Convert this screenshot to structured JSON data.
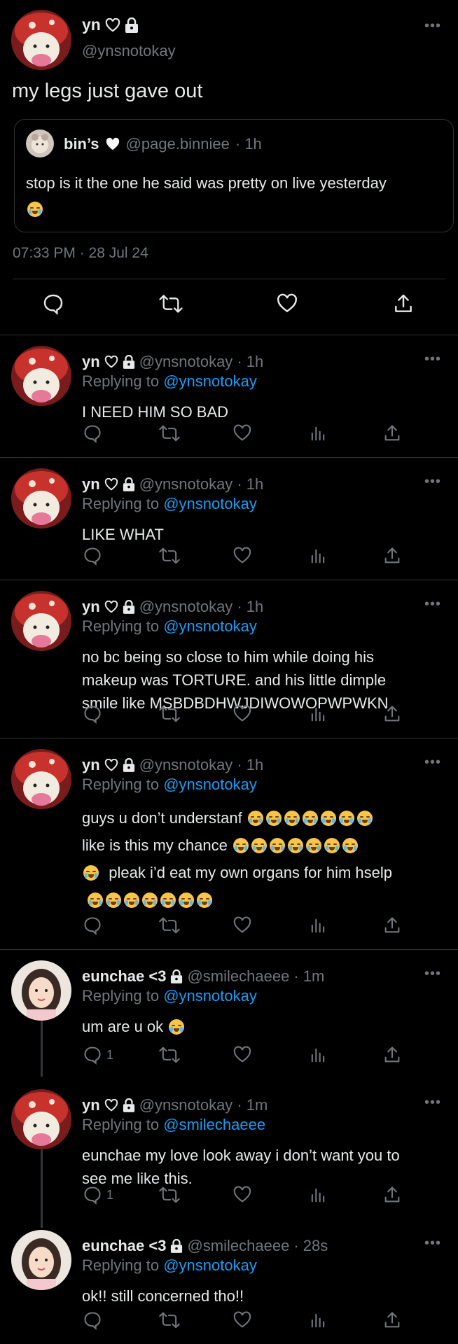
{
  "main_tweet": {
    "author_name": "yn",
    "author_handle": "@ynsnotokay",
    "text": "my legs just gave out",
    "quote": {
      "author_name": "bin’s",
      "author_handle": "@page.binniee",
      "time": "· 1h",
      "text": "stop is it the one he said was pretty on live yesterday"
    },
    "timestamp": "07:33 PM · 28 Jul 24"
  },
  "replies": [
    {
      "name": "yn",
      "handle": "@ynsnotokay",
      "time": "· 1h",
      "replying_label": "Replying to",
      "replying_to": "@ynsnotokay",
      "lines": [
        "I NEED HIM SO BAD"
      ],
      "reply_count": ""
    },
    {
      "name": "yn",
      "handle": "@ynsnotokay",
      "time": "· 1h",
      "replying_label": "Replying to",
      "replying_to": "@ynsnotokay",
      "lines": [
        "LIKE WHAT"
      ],
      "reply_count": ""
    },
    {
      "name": "yn",
      "handle": "@ynsnotokay",
      "time": "· 1h",
      "replying_label": "Replying to",
      "replying_to": "@ynsnotokay",
      "lines": [
        "no bc being so close to him while doing his",
        "makeup was TORTURE. and his little dimple",
        "smile like MSBDBDHWJDIWOWOPWPWKN"
      ],
      "reply_count": ""
    },
    {
      "name": "yn",
      "handle": "@ynsnotokay",
      "time": "· 1h",
      "replying_label": "Replying to",
      "replying_to": "@ynsnotokay",
      "lines": [
        "guys u don’t understanf",
        "like is this my chance",
        "pleak i’d eat my own organs for him hselp",
        ""
      ],
      "reply_count": ""
    },
    {
      "name": "eunchae <3",
      "handle": "@smilechaeee",
      "time": "· 1m",
      "replying_label": "Replying to",
      "replying_to": "@ynsnotokay",
      "lines": [
        "um are u ok"
      ],
      "reply_count": "1"
    },
    {
      "name": "yn",
      "handle": "@ynsnotokay",
      "time": "· 1m",
      "replying_label": "Replying to",
      "replying_to": "@smilechaeee",
      "lines": [
        "eunchae my love look away i don’t want you to",
        "see me like this."
      ],
      "reply_count": "1"
    },
    {
      "name": "eunchae <3",
      "handle": "@smilechaeee",
      "time": "· 28s",
      "replying_label": "Replying to",
      "replying_to": "@ynsnotokay",
      "lines": [
        "ok!! still concerned tho!!"
      ],
      "reply_count": ""
    }
  ],
  "colors": {
    "background": "#000000",
    "text": "#e7e9ea",
    "muted": "#71767b",
    "link": "#1d9bf0",
    "divider": "#2f3336"
  },
  "icons": [
    "heart-outline-icon",
    "lock-icon",
    "more-icon",
    "comment-icon",
    "retweet-icon",
    "like-icon",
    "views-icon",
    "share-icon"
  ]
}
